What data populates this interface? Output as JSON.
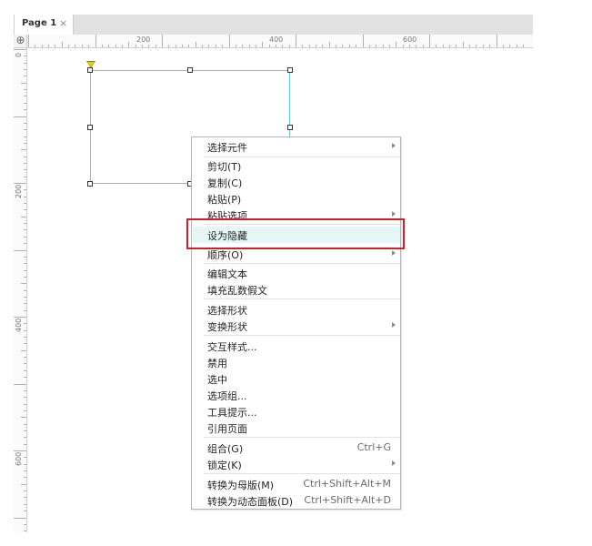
{
  "tab": {
    "label": "Page 1",
    "close": "×"
  },
  "ruler": {
    "corner_icon": "⊕",
    "h_labels": [
      "200",
      "400",
      "600"
    ],
    "v_labels": [
      "0",
      "200",
      "400",
      "600"
    ]
  },
  "menu": {
    "items": [
      {
        "label": "选择元件",
        "submenu": true
      },
      {
        "label": "剪切(T)"
      },
      {
        "label": "复制(C)"
      },
      {
        "label": "粘贴(P)"
      },
      {
        "label": "粘贴选项",
        "submenu": true
      },
      {
        "label": "设为隐藏",
        "highlighted": true
      },
      {
        "label": "顺序(O)",
        "submenu": true
      },
      {
        "label": "编辑文本"
      },
      {
        "label": "填充乱数假文"
      },
      {
        "label": "选择形状"
      },
      {
        "label": "变换形状",
        "submenu": true
      },
      {
        "label": "交互样式..."
      },
      {
        "label": "禁用"
      },
      {
        "label": "选中"
      },
      {
        "label": "选项组..."
      },
      {
        "label": "工具提示..."
      },
      {
        "label": "引用页面"
      },
      {
        "label": "组合(G)",
        "shortcut": "Ctrl+G"
      },
      {
        "label": "锁定(K)",
        "submenu": true
      },
      {
        "label": "转换为母版(M)",
        "shortcut": "Ctrl+Shift+Alt+M"
      },
      {
        "label": "转换为动态面板(D)",
        "shortcut": "Ctrl+Shift+Alt+D"
      }
    ]
  },
  "colors": {
    "highlight_border": "#d0202a",
    "selection_border": "#5fd3d8",
    "highlight_bg": "#e5f6f7"
  }
}
